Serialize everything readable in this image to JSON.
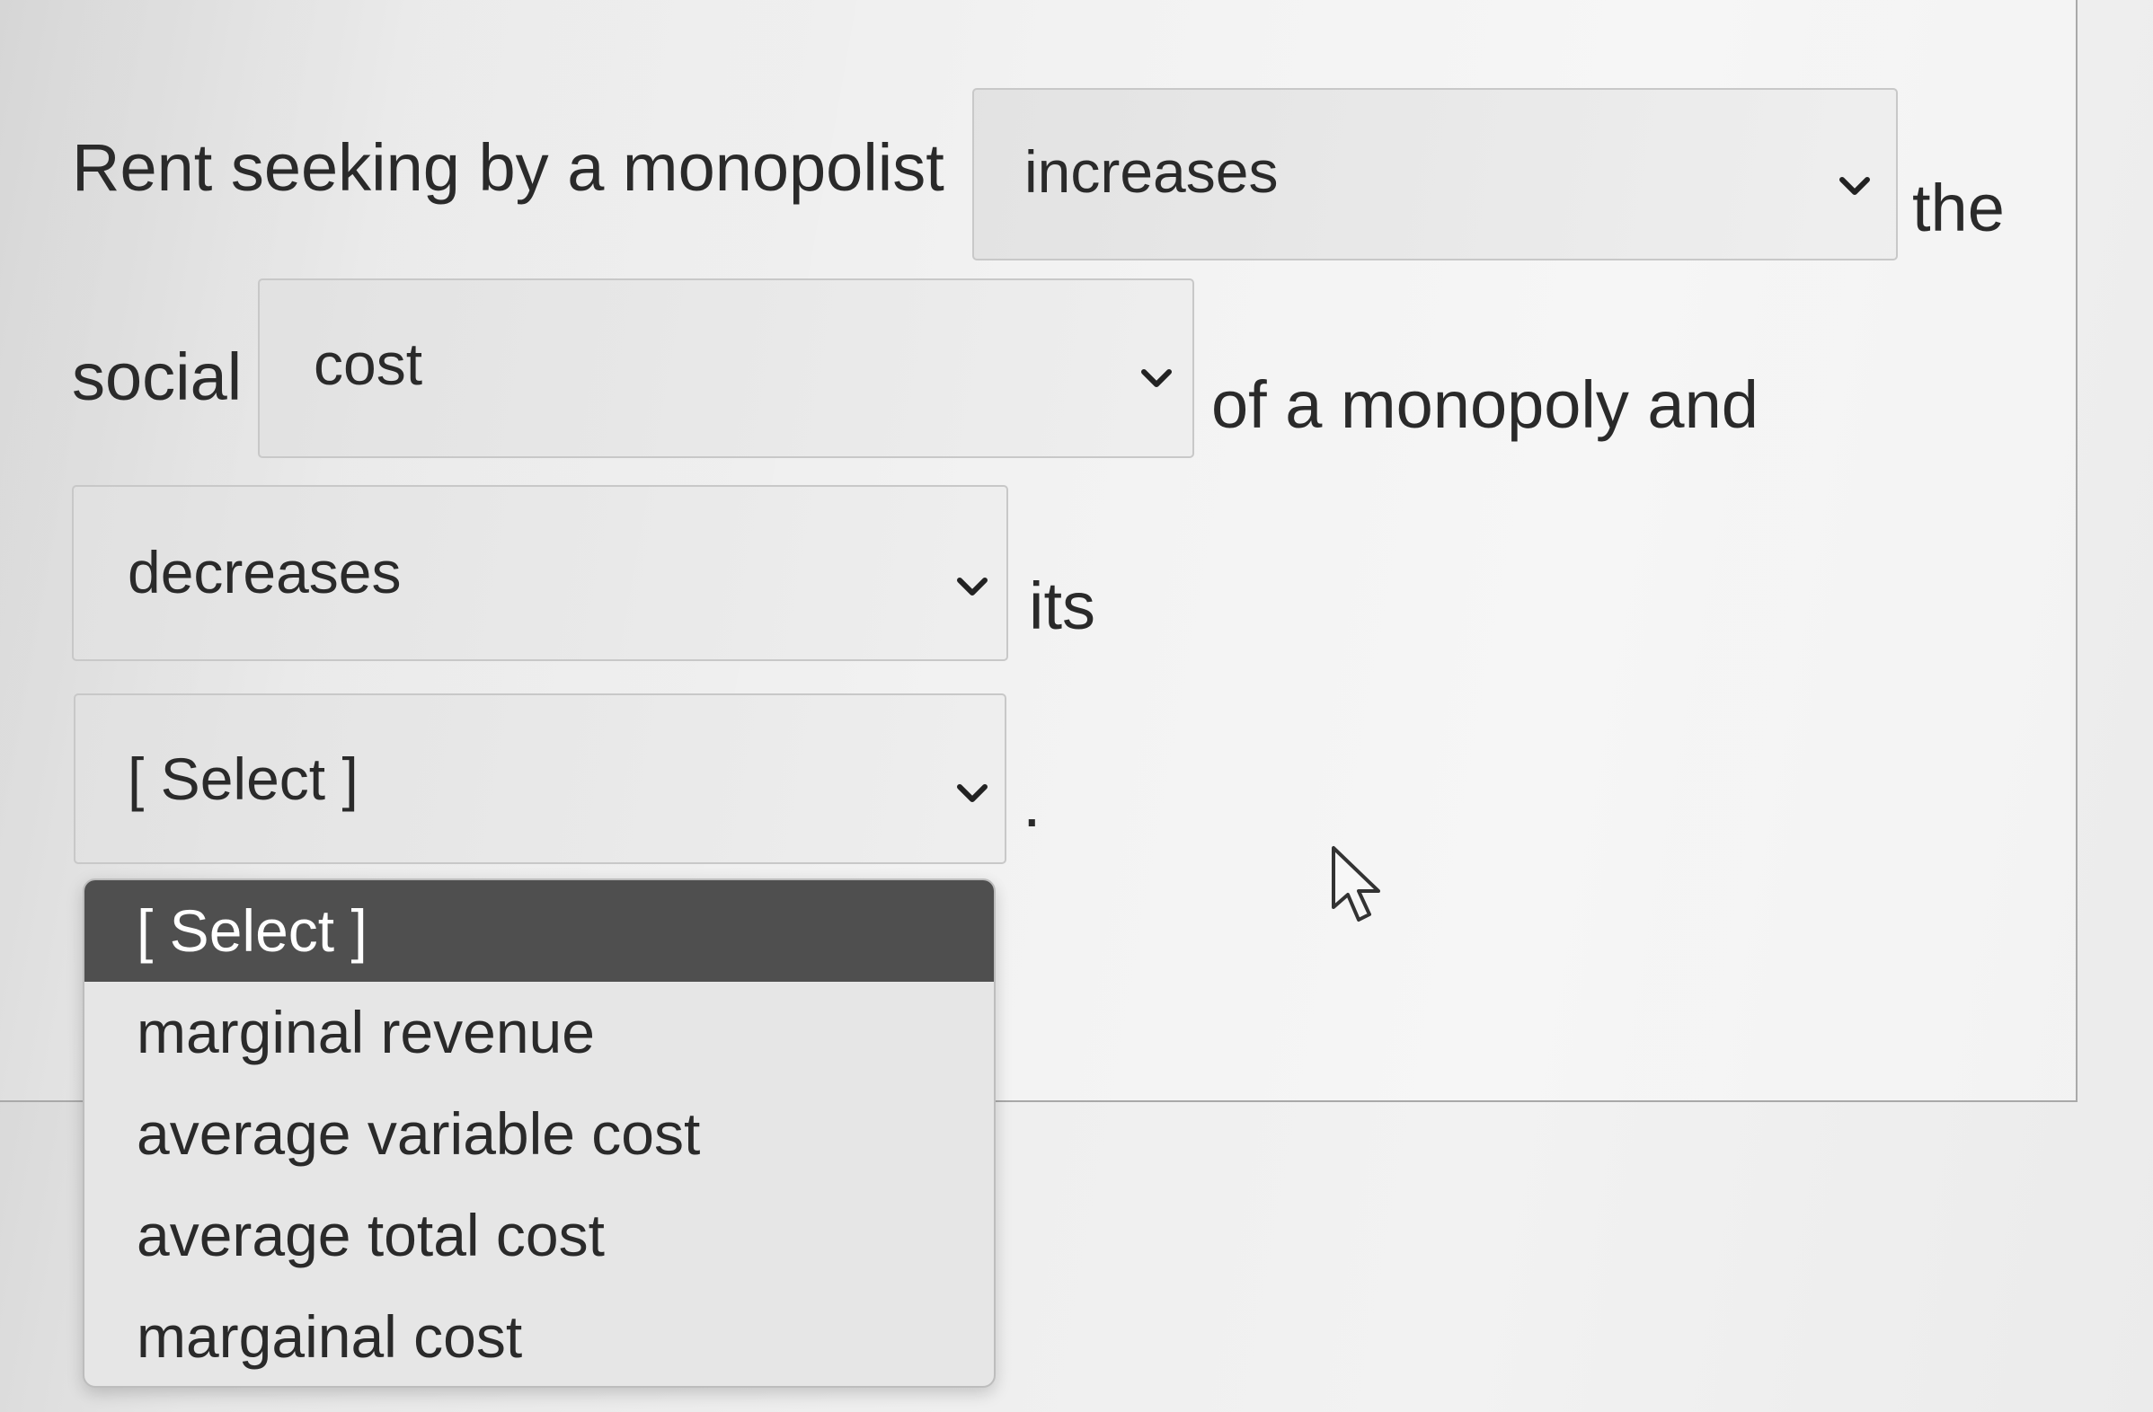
{
  "sentence": {
    "part1": "Rent seeking by a monopolist",
    "part2": "the",
    "part3": "social",
    "part4": "of a monopoly and",
    "part5": "its",
    "part6": "."
  },
  "dropdowns": {
    "effect_1": {
      "value": "increases"
    },
    "measure": {
      "value": "cost"
    },
    "effect_2": {
      "value": "decreases"
    },
    "cost_type": {
      "value": "[ Select ]"
    }
  },
  "open_list": {
    "options": [
      "[ Select ]",
      "marginal revenue",
      "average variable cost",
      "average total cost",
      "margainal cost"
    ],
    "highlighted_index": 0
  },
  "icons": {
    "dropdown": "chevron-down-icon",
    "cursor": "mouse-pointer-icon"
  }
}
